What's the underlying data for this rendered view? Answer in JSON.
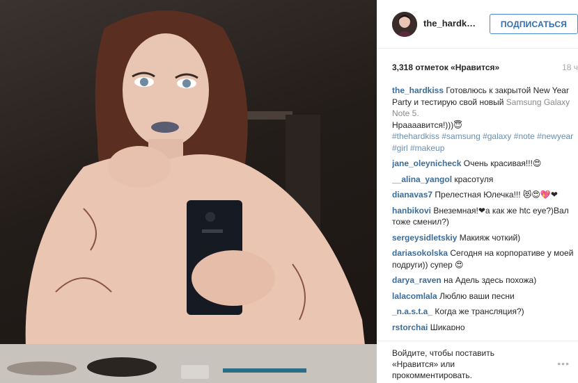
{
  "post": {
    "photo_alt": ""
  },
  "header": {
    "username": "the_hardk…",
    "follow_label": "ПОДПИСАТЬСЯ"
  },
  "meta": {
    "likes": "3,318 отметок «Нравится»",
    "age": "18 ч"
  },
  "caption": {
    "author": "the_hardkiss",
    "text_part1": "Готовлюсь к закрытой New Year Party и тестирую свой новый",
    "text_part2": "Samsung Galaxy Note 5.",
    "text_part3": "Нраааавится!)))😇",
    "hashtags": "#thehardkiss #samsung #galaxy #note #newyear #girl #makeup"
  },
  "comments": [
    {
      "author": "jane_oleynicheck",
      "text": "Очень красивая!!!😍"
    },
    {
      "author": "__alina_yangol",
      "text": "красотуля"
    },
    {
      "author": "dianavas7",
      "text": "Прелестная Юлечка!!! 😻😍💖❤"
    },
    {
      "author": "hanbikovi",
      "text": "Внеземная!❤а как же htc eye?)Вал тоже сменил?)"
    },
    {
      "author": "sergeysidletskiy",
      "text": "Макияж чоткий)"
    },
    {
      "author": "dariasokolska",
      "text": "Сегодня на корпоративе у моей подруги)) супер 😍"
    },
    {
      "author": "darya_raven",
      "text": "на Адель здесь похожа)"
    },
    {
      "author": "lalacomlala",
      "text": "Люблю ваши песни"
    },
    {
      "author": "_n.a.s.t.a_",
      "text": "Когда же трансляция?)"
    },
    {
      "author": "rstorchai",
      "text": "Шикарно"
    }
  ],
  "footer": {
    "login_link": "Войдите",
    "login_rest": ", чтобы поставить «Нравится» или прокомментировать.",
    "more_icon": "ellipsis-icon"
  }
}
